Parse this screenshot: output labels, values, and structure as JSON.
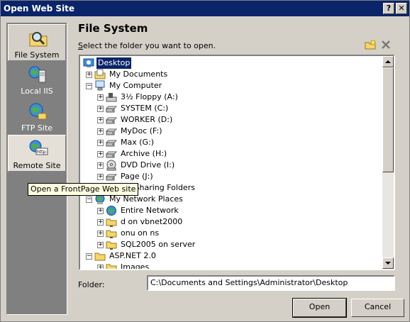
{
  "window": {
    "title": "Open Web Site",
    "help_glyph": "?",
    "close_glyph": "✕"
  },
  "places": [
    {
      "label": "File System",
      "icon": "folder-search-icon"
    },
    {
      "label": "Local IIS",
      "icon": "iis-server-icon"
    },
    {
      "label": "FTP Site",
      "icon": "ftp-globe-icon"
    },
    {
      "label": "Remote Site",
      "icon": "remote-http-icon"
    }
  ],
  "tooltip": "Open a FrontPage Web site",
  "main": {
    "heading": "File System",
    "instruction_prefix": "S",
    "instruction_rest": "elect the folder you want to open."
  },
  "tree": [
    {
      "label": "Desktop",
      "icon": "desktop-icon",
      "selected": true
    },
    {
      "label": "My Documents",
      "icon": "my-documents-icon",
      "expander": "+"
    },
    {
      "label": "My Computer",
      "icon": "my-computer-icon",
      "expander": "−"
    },
    {
      "label": "3½ Floppy (A:)",
      "icon": "floppy-drive-icon",
      "expander": "+"
    },
    {
      "label": "SYSTEM (C:)",
      "icon": "hard-drive-icon",
      "expander": "+"
    },
    {
      "label": "WORKER (D:)",
      "icon": "hard-drive-icon",
      "expander": "+"
    },
    {
      "label": "MyDoc (F:)",
      "icon": "hard-drive-icon",
      "expander": "+"
    },
    {
      "label": "Max (G:)",
      "icon": "hard-drive-icon",
      "expander": "+"
    },
    {
      "label": "Archive (H:)",
      "icon": "hard-drive-icon",
      "expander": "+"
    },
    {
      "label": "DVD Drive (I:)",
      "icon": "dvd-drive-icon",
      "expander": "+"
    },
    {
      "label": "Page (J:)",
      "icon": "hard-drive-icon",
      "expander": "+"
    },
    {
      "label": "My Sharing Folders",
      "icon": "shared-folder-icon",
      "expander": "+"
    },
    {
      "label": "My Network Places",
      "icon": "network-places-icon",
      "expander": "−"
    },
    {
      "label": "Entire Network",
      "icon": "globe-icon",
      "expander": "+"
    },
    {
      "label": "d on vbnet2000",
      "icon": "network-folder-icon",
      "expander": "+"
    },
    {
      "label": "onu on ns",
      "icon": "network-folder-icon",
      "expander": "+"
    },
    {
      "label": "SQL2005 on server",
      "icon": "network-folder-icon",
      "expander": "+"
    },
    {
      "label": "ASP.NET 2.0",
      "icon": "folder-icon",
      "expander": "−"
    },
    {
      "label": "Images",
      "icon": "folder-icon",
      "expander": "+"
    }
  ],
  "folder": {
    "label": "Folder:",
    "value": "C:\\Documents and Settings\\Administrator\\Desktop"
  },
  "buttons": {
    "open": "Open",
    "cancel": "Cancel"
  },
  "colors": {
    "titlebar": "#0a246a",
    "selection": "#0a246a",
    "tooltip_bg": "#ffffe1"
  }
}
